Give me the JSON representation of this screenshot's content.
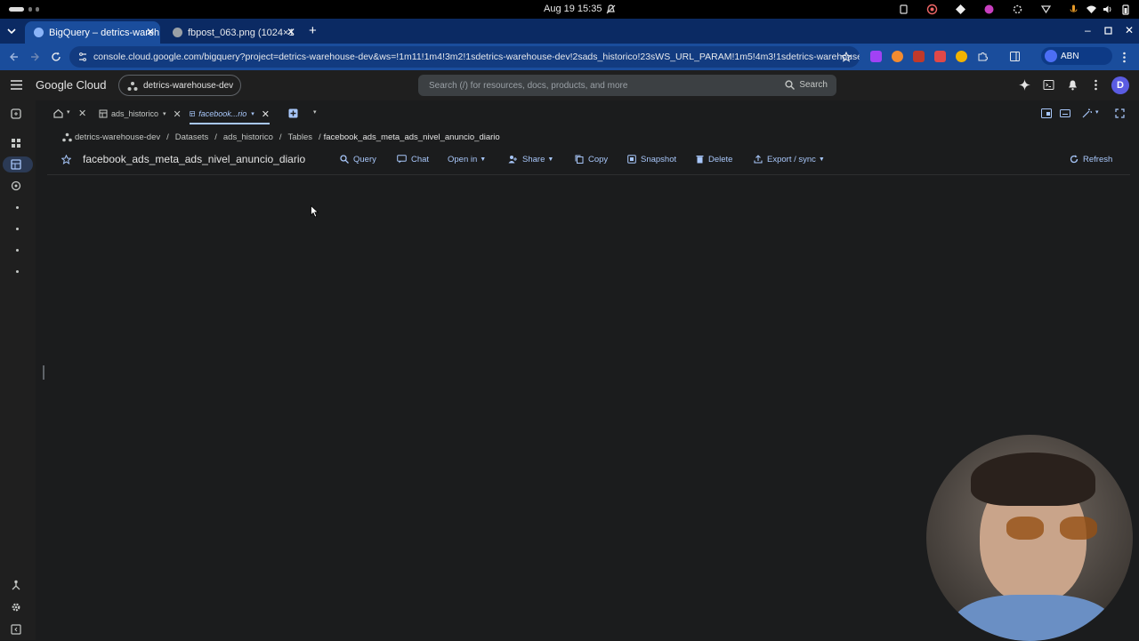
{
  "os": {
    "clock": "Aug 19  15:35"
  },
  "browser": {
    "tabs": [
      {
        "label": "BigQuery – detrics-wareh",
        "active": true
      },
      {
        "label": "fbpost_063.png (1024×1",
        "active": false
      }
    ],
    "new_tab_label": "+",
    "url": "console.cloud.google.com/bigquery?project=detrics-warehouse-dev&ws=!1m11!1m4!3m2!1sdetrics-warehouse-dev!2sads_historico!23sWS_URL_PARAM!1m5!4m3!1sdetrics-warehouse-dev!2sads_h...",
    "profile_label": "ABN"
  },
  "gc_header": {
    "logo": "Google Cloud",
    "project": "detrics-warehouse-dev",
    "search_placeholder": "Search (/) for resources, docs, products, and more",
    "search_button": "Search",
    "avatar_letter": "D"
  },
  "workspace_tabs": [
    {
      "label": "ads_historico",
      "active": false
    },
    {
      "label": "facebook...rio",
      "active": true
    }
  ],
  "breadcrumb": {
    "project": "detrics-warehouse-dev",
    "items": [
      "Datasets",
      "ads_historico",
      "Tables",
      "facebook_ads_meta_ads_nivel_anuncio_diario"
    ]
  },
  "table": {
    "title": "facebook_ads_meta_ads_nivel_anuncio_diario",
    "actions": {
      "query": "Query",
      "chat": "Chat",
      "open_in": "Open in",
      "share": "Share",
      "copy": "Copy",
      "snapshot": "Snapshot",
      "delete": "Delete",
      "export": "Export / sync",
      "refresh": "Refresh"
    }
  },
  "colors": {
    "accent": "#a8c7fa",
    "chrome_tab_strip": "#0b2a63",
    "chrome_toolbar": "#1a4d9c",
    "background": "#1b1c1d"
  }
}
